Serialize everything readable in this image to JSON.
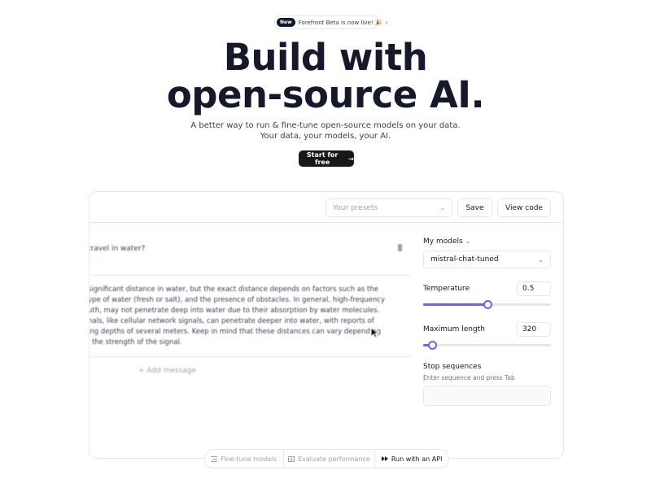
{
  "announcement": {
    "badge": "New",
    "text": "Forefront Beta is now live! 🎉",
    "chevron": "›"
  },
  "hero": {
    "title_line1": "Build with",
    "title_line2": "open-source AI.",
    "subtitle_line1": "A better way to run & fine-tune open-source models on your data.",
    "subtitle_line2": "Your data, your models, your AI.",
    "cta_label": "Start for free",
    "cta_arrow": "→"
  },
  "toolbar": {
    "presets_placeholder": "Your presets",
    "save_label": "Save",
    "view_code_label": "View code"
  },
  "chat": {
    "user_message": "travel in water?",
    "assistant_lines": [
      "significant distance in water, but the exact distance depends on factors such as the",
      "ype of water (fresh or salt), and the presence of obstacles. In general, high-frequency",
      "uth, may not penetrate deep into water due to their absorption by water molecules.",
      "nals, like cellular network signals, can penetrate deeper into water, with reports of",
      "ing depths of several meters. Keep in mind that these distances can vary depending",
      "l the strength of the signal."
    ],
    "add_message_label": "Add message"
  },
  "settings": {
    "my_models_label": "My models",
    "model_value": "mistral-chat-tuned",
    "temperature": {
      "label": "Temperature",
      "value": "0.5",
      "fraction": 0.5
    },
    "max_length": {
      "label": "Maximum length",
      "value": "320",
      "fraction": 0.07
    },
    "stop_sequences": {
      "label": "Stop sequences",
      "help": "Enter sequence and press Tab"
    }
  },
  "bottom_tabs": [
    {
      "label": "Fine-tune models",
      "icon": "list-icon",
      "active": false
    },
    {
      "label": "Evaluate performance",
      "icon": "chart-icon",
      "active": false
    },
    {
      "label": "Run with an API",
      "icon": "fast-forward-icon",
      "active": true
    }
  ],
  "colors": {
    "accent": "#6366f1",
    "primary_button": "#18181b",
    "border": "#e5e7eb"
  }
}
